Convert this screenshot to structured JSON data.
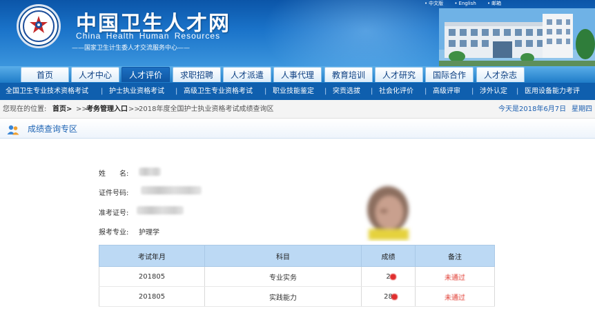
{
  "header": {
    "site_title": "中国卫生人才网",
    "site_title_en": "China Health  Human  Resources",
    "site_subtitle": "——国家卫生计生委人才交流服务中心——",
    "lang_links": [
      "中文版",
      "English",
      "邮箱"
    ]
  },
  "nav": {
    "items": [
      "首页",
      "人才中心",
      "人才评价",
      "求职招聘",
      "人才派遣",
      "人事代理",
      "教育培训",
      "人才研究",
      "国际合作",
      "人才杂志"
    ],
    "active_index": 2
  },
  "subnav": {
    "items": [
      "全国卫生专业技术资格考试",
      "护士执业资格考试",
      "高级卫生专业资格考试",
      "职业技能鉴定",
      "突贡选拔",
      "社会化评价",
      "高级评审",
      "涉外认定",
      "医用设备能力考评"
    ]
  },
  "breadcrumb": {
    "prefix": "您现在的位置:",
    "home": "首页>",
    "sep1": ">>",
    "exam_mgmt": "考务管理入口",
    "sep2": ">>",
    "page": "2018年度全国护士执业资格考试成绩查询区",
    "date": "今天是2018年6月7日",
    "weekday": "星期四"
  },
  "section": {
    "title": "成绩查询专区"
  },
  "candidate": {
    "name_label": "姓　　名:",
    "id_label": "证件号码:",
    "ticket_label": "准考证号:",
    "major_label": "报考专业:",
    "major_value": "护理学"
  },
  "score_table": {
    "headers": [
      "考试年月",
      "科目",
      "成绩",
      "备注"
    ],
    "rows": [
      {
        "date": "201805",
        "subject": "专业实务",
        "score": "2",
        "note": "未通过"
      },
      {
        "date": "201805",
        "subject": "实践能力",
        "score": "28",
        "note": "未通过"
      }
    ]
  },
  "colors": {
    "banner_blue": "#0b55a8",
    "nav_blue": "#1f7cc8",
    "subnav_blue": "#0f5fae",
    "table_header": "#bcd9f4",
    "fail_red": "#e0362c"
  }
}
